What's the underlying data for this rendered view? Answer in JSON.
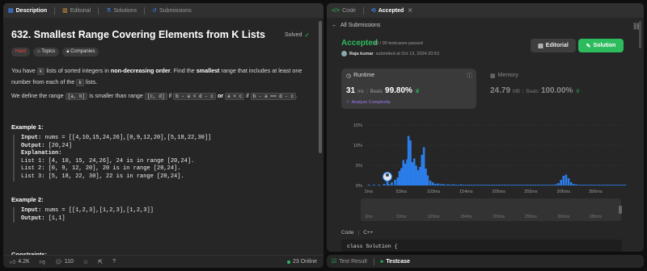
{
  "left": {
    "tabs": [
      {
        "label": "Description",
        "icon": "description-icon"
      },
      {
        "label": "Editorial",
        "icon": "editorial-icon"
      },
      {
        "label": "Solutions",
        "icon": "solutions-icon"
      },
      {
        "label": "Submissions",
        "icon": "submissions-icon"
      }
    ],
    "title": "632. Smallest Range Covering Elements from K Lists",
    "solved_label": "Solved",
    "difficulty": "Hard",
    "topics_label": "Topics",
    "companies_label": "Companies",
    "desc1": {
      "a": "You have ",
      "k": "k",
      "b": " lists of sorted integers in ",
      "c": "non-decreasing order",
      "d": ". Find the ",
      "e": "smallest",
      "f": " range that includes at least one",
      "g": "number from each of the ",
      "h": "k",
      "i": " lists."
    },
    "desc2": {
      "a": "We define the range ",
      "r1": "[a, b]",
      "b": " is smaller than range ",
      "r2": "[c, d]",
      "c": " if ",
      "cond1": "b - a < d - c",
      "d": " or ",
      "cond2": "a < c",
      "e": " if ",
      "cond3": "b - a == d - c",
      "f": "."
    },
    "example1": {
      "heading": "Example 1:",
      "input_label": "Input:",
      "input": " nums = [[4,10,15,24,26],[0,9,12,20],[5,18,22,30]]",
      "output_label": "Output:",
      "output": " [20,24]",
      "explanation_label": "Explanation:",
      "lines": [
        "List 1: [4, 10, 15, 24,26], 24 is in range [20,24].",
        "List 2: [0, 9, 12, 20], 20 is in range [20,24].",
        "List 3: [5, 18, 22, 30], 22 is in range [20,24]."
      ]
    },
    "example2": {
      "heading": "Example 2:",
      "input_label": "Input:",
      "input": " nums = [[1,2,3],[1,2,3],[1,2,3]]",
      "output_label": "Output:",
      "output": " [1,1]"
    },
    "constraints_heading": "Constraints:",
    "footer": {
      "likes": "4.2K",
      "comments": "110",
      "online": "23 Online"
    }
  },
  "right": {
    "tabs": [
      {
        "label": "Code",
        "icon": "code-icon"
      },
      {
        "label": "Accepted",
        "icon": "accepted-icon"
      }
    ],
    "all_submissions": "All Submissions",
    "status": "Accepted",
    "testcases": "90 / 90 testcases passed",
    "user": "Raja kumar",
    "submitted": "submitted at Oct 13, 2024 20:53",
    "editorial_btn": "Editorial",
    "solution_btn": "Solution",
    "runtime": {
      "label": "Runtime",
      "value": "31",
      "unit": "ms",
      "beats_label": "Beats",
      "beats": "99.80%",
      "analyze": "Analyze Complexity"
    },
    "memory": {
      "label": "Memory",
      "value": "24.79",
      "unit": "MB",
      "beats_label": "Beats",
      "beats": "100.00%"
    },
    "code_lang_tabs": [
      "Code",
      "C++"
    ],
    "code_line": "class Solution {",
    "bottom_tabs": [
      {
        "label": "Test Result"
      },
      {
        "label": "Testcase"
      }
    ]
  },
  "chart_data": {
    "type": "bar",
    "y_ticks": [
      "15%",
      "10%",
      "5%",
      "0%"
    ],
    "ylim": [
      0,
      16
    ],
    "x_ticks": [
      "2ms",
      "53ms",
      "103ms",
      "154ms",
      "205ms",
      "255ms",
      "306ms",
      "356ms"
    ],
    "xlim": [
      2,
      406
    ],
    "highlight_x": 31,
    "bar_color": "#2b7de9",
    "values": [
      [
        2,
        0.2
      ],
      [
        10,
        0.2
      ],
      [
        18,
        0.2
      ],
      [
        26,
        0.4
      ],
      [
        31,
        1.0
      ],
      [
        34,
        0.3
      ],
      [
        38,
        0.8
      ],
      [
        43,
        1.4
      ],
      [
        47,
        2.0
      ],
      [
        50,
        3.6
      ],
      [
        53,
        4.3
      ],
      [
        56,
        6.3
      ],
      [
        59,
        5.4
      ],
      [
        62,
        6.5
      ],
      [
        64,
        12.3
      ],
      [
        67,
        11.2
      ],
      [
        70,
        5.8
      ],
      [
        73,
        6.7
      ],
      [
        76,
        4.9
      ],
      [
        79,
        3.8
      ],
      [
        82,
        4.6
      ],
      [
        85,
        7.6
      ],
      [
        88,
        9.5
      ],
      [
        91,
        4.2
      ],
      [
        94,
        2.5
      ],
      [
        98,
        1.2
      ],
      [
        102,
        0.8
      ],
      [
        106,
        0.4
      ],
      [
        110,
        0.5
      ],
      [
        114,
        0.3
      ],
      [
        118,
        0.4
      ],
      [
        122,
        0.2
      ],
      [
        126,
        0.3
      ],
      [
        130,
        0.2
      ],
      [
        134,
        0.3
      ],
      [
        138,
        0.2
      ],
      [
        142,
        0.2
      ],
      [
        146,
        0.3
      ],
      [
        150,
        0.2
      ],
      [
        154,
        0.2
      ],
      [
        158,
        0.2
      ],
      [
        162,
        0.2
      ],
      [
        166,
        0.2
      ],
      [
        170,
        0.2
      ],
      [
        174,
        0.2
      ],
      [
        178,
        0.2
      ],
      [
        182,
        0.2
      ],
      [
        186,
        0.2
      ],
      [
        190,
        0.2
      ],
      [
        194,
        0.2
      ],
      [
        198,
        0.2
      ],
      [
        202,
        0.2
      ],
      [
        206,
        0.2
      ],
      [
        210,
        0.2
      ],
      [
        214,
        0.2
      ],
      [
        218,
        0.2
      ],
      [
        222,
        0.2
      ],
      [
        226,
        0.2
      ],
      [
        230,
        0.2
      ],
      [
        234,
        0.2
      ],
      [
        238,
        0.2
      ],
      [
        242,
        0.2
      ],
      [
        246,
        0.2
      ],
      [
        250,
        0.2
      ],
      [
        254,
        0.2
      ],
      [
        258,
        0.2
      ],
      [
        262,
        0.2
      ],
      [
        266,
        0.2
      ],
      [
        270,
        0.2
      ],
      [
        274,
        0.2
      ],
      [
        278,
        0.2
      ],
      [
        282,
        0.2
      ],
      [
        286,
        0.2
      ],
      [
        290,
        0.2
      ],
      [
        294,
        0.3
      ],
      [
        298,
        0.6
      ],
      [
        302,
        1.4
      ],
      [
        306,
        2.4
      ],
      [
        310,
        2.7
      ],
      [
        314,
        1.8
      ],
      [
        318,
        0.8
      ],
      [
        322,
        0.4
      ],
      [
        326,
        0.3
      ],
      [
        330,
        0.2
      ],
      [
        334,
        0.2
      ],
      [
        338,
        0.2
      ],
      [
        342,
        0.2
      ],
      [
        346,
        0.2
      ],
      [
        350,
        0.2
      ],
      [
        354,
        0.2
      ],
      [
        358,
        0.2
      ],
      [
        362,
        0.2
      ],
      [
        366,
        0.2
      ],
      [
        370,
        0.2
      ],
      [
        374,
        0.2
      ],
      [
        378,
        0.2
      ],
      [
        382,
        0.2
      ],
      [
        386,
        0.2
      ],
      [
        390,
        0.2
      ],
      [
        394,
        0.2
      ],
      [
        398,
        0.2
      ],
      [
        402,
        0.2
      ]
    ]
  },
  "colors": {
    "green": "#2cbb5d",
    "hard": "#ef4743",
    "accent": "#2b7de9"
  }
}
